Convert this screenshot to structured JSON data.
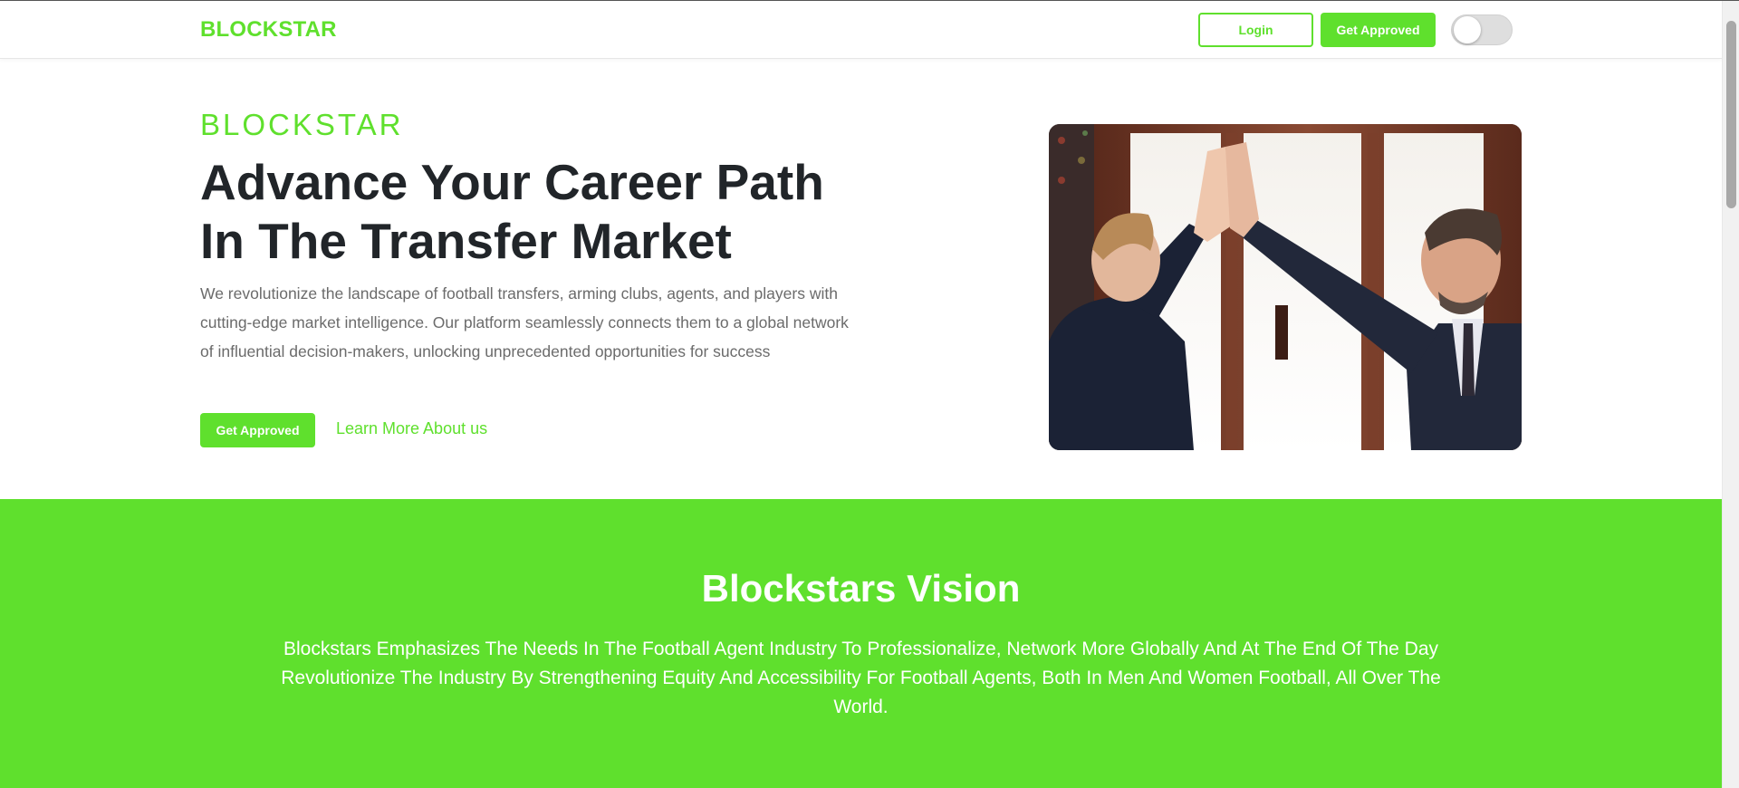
{
  "navbar": {
    "brand": "BLOCKSTAR",
    "login_label": "Login",
    "get_approved_label": "Get Approved"
  },
  "hero": {
    "eyebrow": "BLOCKSTAR",
    "headline_line1": "Advance Your Career Path",
    "headline_line2": "In The Transfer Market",
    "lead": "We revolutionize the landscape of football transfers, arming clubs, agents, and players with cutting-edge market intelligence. Our platform seamlessly connects them to a global network of influential decision-makers, unlocking unprecedented opportunities for success",
    "get_approved_label": "Get Approved",
    "learn_more_label": "Learn More About us"
  },
  "vision": {
    "title": "Blockstars Vision",
    "text": "Blockstars Emphasizes The Needs In The Football Agent Industry To Professionalize, Network More Globally And At The End Of The Day Revolutionize The Industry By Strengthening Equity And Accessibility For Football Agents, Both In Men And Women Football, All Over The World."
  },
  "colors": {
    "accent": "#5fe02d",
    "heading": "#212529",
    "body_text": "#6b6b6b"
  },
  "icons": {
    "theme_toggle": "toggle-switch-icon"
  }
}
